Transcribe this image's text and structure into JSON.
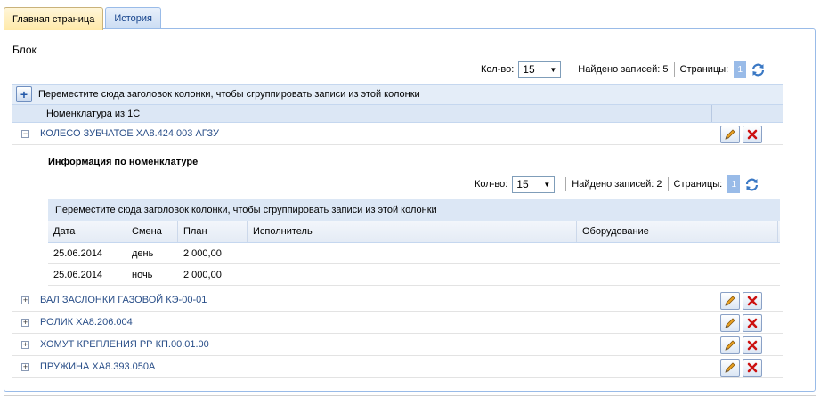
{
  "tabs": [
    {
      "label": "Главная страница",
      "active": true
    },
    {
      "label": "История",
      "active": false
    }
  ],
  "block_title": "Блок",
  "main_pager": {
    "count_label": "Кол-во:",
    "count_value": "15",
    "found_label": "Найдено записей: 5",
    "pages_label": "Страницы:",
    "current_page": "1"
  },
  "main_grid": {
    "group_hint": "Переместите сюда заголовок колонки, чтобы сгруппировать записи из этой колонки",
    "column": "Номенклатура из 1С",
    "rows": [
      {
        "name": "КОЛЕСО ЗУБЧАТОЕ ХА8.424.003 АГЗУ",
        "expanded": true
      },
      {
        "name": "ВАЛ ЗАСЛОНКИ ГАЗОВОЙ КЭ-00-01",
        "expanded": false
      },
      {
        "name": "РОЛИК ХА8.206.004",
        "expanded": false
      },
      {
        "name": "ХОМУТ КРЕПЛЕНИЯ РР КП.00.01.00",
        "expanded": false
      },
      {
        "name": "ПРУЖИНА ХА8.393.050А",
        "expanded": false
      }
    ]
  },
  "detail": {
    "title": "Информация по номенклатуре",
    "pager": {
      "count_label": "Кол-во:",
      "count_value": "15",
      "found_label": "Найдено записей: 2",
      "pages_label": "Страницы:",
      "current_page": "1"
    },
    "group_hint": "Переместите сюда заголовок колонки, чтобы сгруппировать записи из этой колонки",
    "columns": [
      "Дата",
      "Смена",
      "План",
      "Исполнитель",
      "Оборудование"
    ],
    "rows": [
      [
        "25.06.2014",
        "день",
        "2 000,00",
        "",
        ""
      ],
      [
        "25.06.2014",
        "ночь",
        "2 000,00",
        "",
        ""
      ]
    ]
  },
  "colors": {
    "accent": "#99bbe8",
    "link": "#2a4f89",
    "delete": "#cc1111",
    "edit": "#e8a020"
  },
  "icons": {
    "add": "plus-icon",
    "edit": "pencil-icon",
    "delete": "close-icon",
    "refresh": "refresh-icon"
  }
}
